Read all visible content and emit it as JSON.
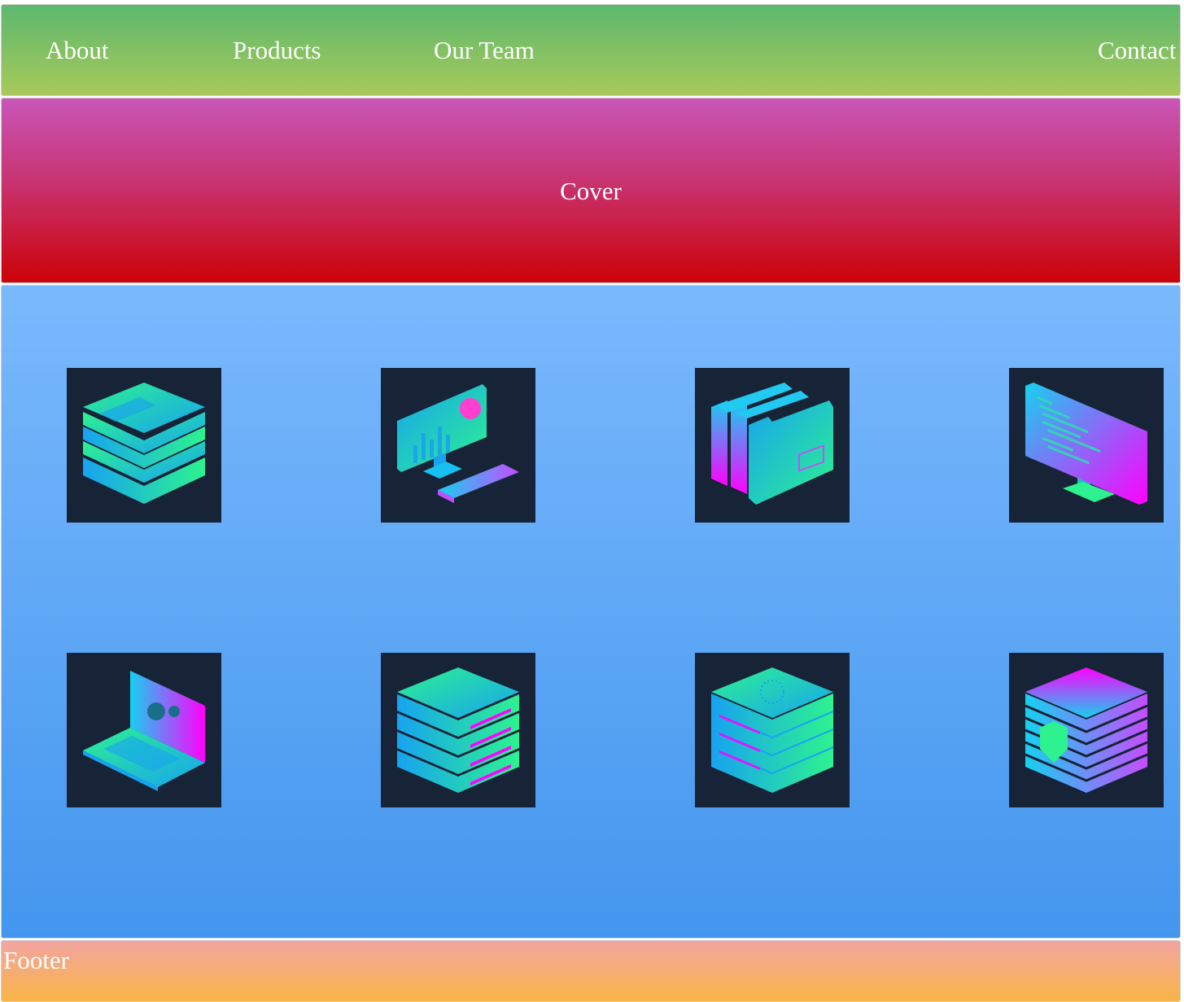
{
  "nav": {
    "links": [
      {
        "label": "About"
      },
      {
        "label": "Products"
      },
      {
        "label": "Our Team"
      },
      {
        "label": "Contact"
      }
    ]
  },
  "cover": {
    "title": "Cover"
  },
  "gallery": {
    "items": [
      {
        "icon": "database-stack-icon"
      },
      {
        "icon": "analytics-monitor-icon"
      },
      {
        "icon": "folders-icon"
      },
      {
        "icon": "code-monitor-icon"
      },
      {
        "icon": "laptop-settings-icon"
      },
      {
        "icon": "server-rack-icon"
      },
      {
        "icon": "data-server-icon"
      },
      {
        "icon": "security-shield-stack-icon"
      }
    ]
  },
  "footer": {
    "text": "Footer"
  },
  "colors": {
    "nav_top": "#5cb86e",
    "nav_bottom": "#a8c95a",
    "cover_top": "#c956b9",
    "cover_bottom": "#cc0208",
    "gallery_top": "#7ab9fd",
    "gallery_bottom": "#4396ee",
    "tile_bg": "#172336",
    "footer_top": "#f2a5a1",
    "footer_bottom": "#f8b445",
    "icon_green": "#2df28f",
    "icon_blue": "#17a3f0",
    "icon_magenta": "#ff00ff"
  }
}
